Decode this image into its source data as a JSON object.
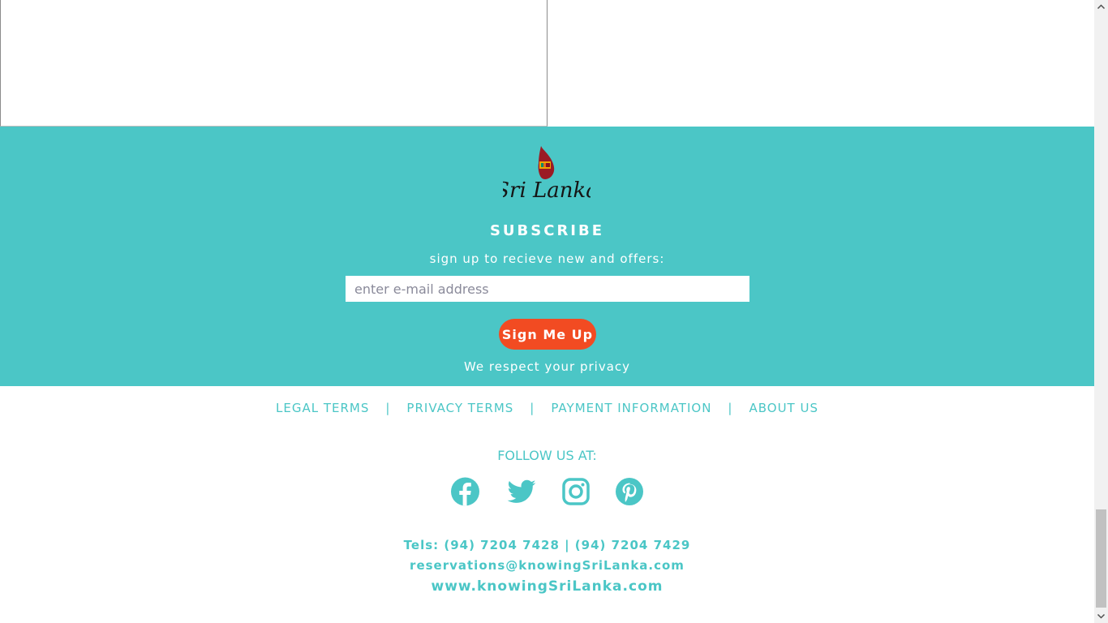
{
  "subscribe": {
    "logo_text": "Sri Lanka",
    "title": "SUBSCRIBE",
    "subtitle": "sign up to recieve new and offers:",
    "email_placeholder": "enter e-mail address",
    "button_label": "Sign Me Up",
    "privacy_note": "We respect your privacy",
    "band_color": "#4bc6c6",
    "button_color": "#f24b22"
  },
  "footer_links": {
    "legal": "LEGAL TERMS",
    "privacy": "PRIVACY TERMS",
    "payment": "PAYMENT INFORMATION",
    "about": "ABOUT US",
    "separator": "|"
  },
  "social": {
    "heading": "FOLLOW US AT:",
    "icons": [
      "facebook-icon",
      "twitter-icon",
      "instagram-icon",
      "pinterest-icon"
    ]
  },
  "contact": {
    "tels": "Tels: (94) 7204 7428 | (94) 7204 7429",
    "email": "reservations@knowingSriLanka.com",
    "website": "www.knowingSriLanka.com"
  }
}
